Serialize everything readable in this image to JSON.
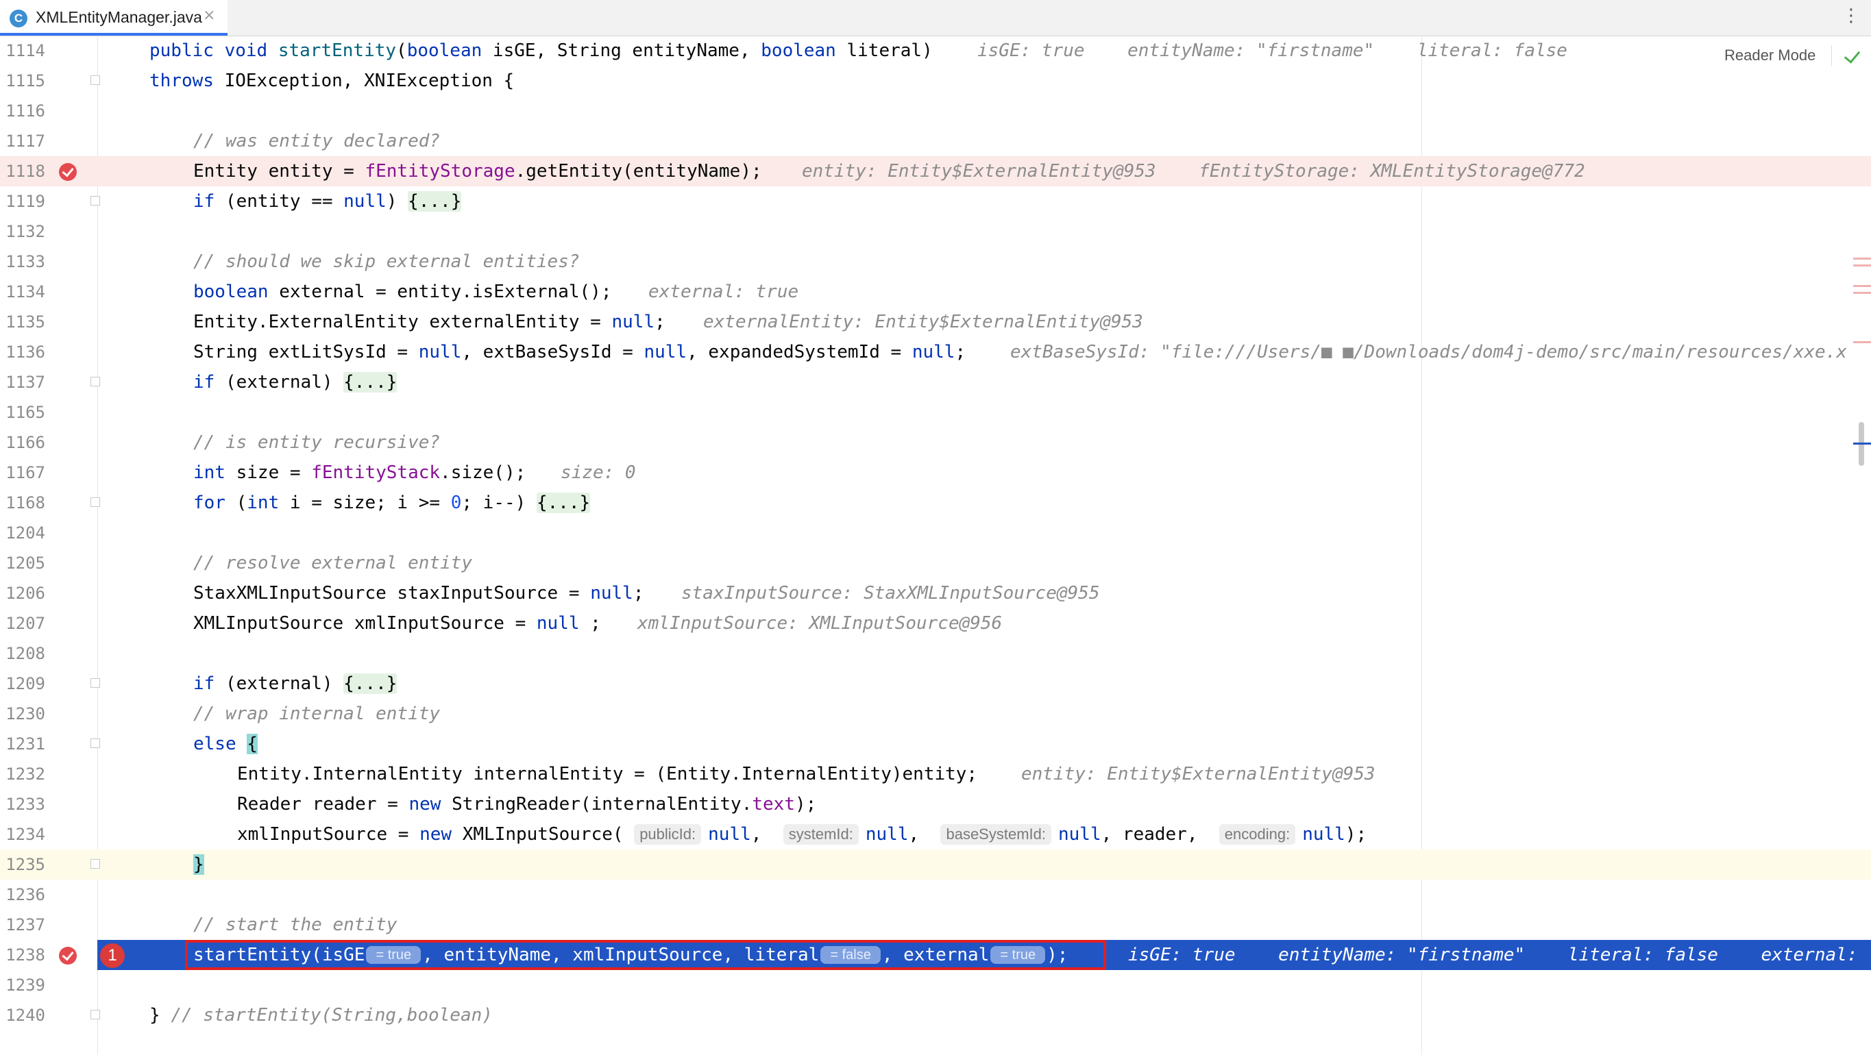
{
  "tab": {
    "icon_letter": "C",
    "file_name": "XMLEntityManager.java",
    "close_glyph": "×"
  },
  "editor": {
    "reader_mode_label": "Reader Mode",
    "lines": {
      "l1114": {
        "number": "1114",
        "hint": "isGE: true    entityName: \"firstname\"    literal: false"
      },
      "l1115": {
        "number": "1115"
      },
      "l1116": {
        "number": "1116"
      },
      "l1117": {
        "number": "1117",
        "comment": "// was entity declared?"
      },
      "l1118": {
        "number": "1118",
        "hint": "entity: Entity$ExternalEntity@953    fEntityStorage: XMLEntityStorage@772"
      },
      "l1119": {
        "number": "1119",
        "folded": "{...}"
      },
      "l1132": {
        "number": "1132"
      },
      "l1133": {
        "number": "1133",
        "comment": "// should we skip external entities?"
      },
      "l1134": {
        "number": "1134",
        "hint": "external: true"
      },
      "l1135": {
        "number": "1135",
        "hint": "externalEntity: Entity$ExternalEntity@953"
      },
      "l1136": {
        "number": "1136",
        "hint": "extBaseSysId: \"file:///Users/■ ■/Downloads/dom4j-demo/src/main/resources/xxe.x"
      },
      "l1137": {
        "number": "1137",
        "folded": "{...}"
      },
      "l1165": {
        "number": "1165"
      },
      "l1166": {
        "number": "1166",
        "comment": "// is entity recursive?"
      },
      "l1167": {
        "number": "1167",
        "hint": "size: 0"
      },
      "l1168": {
        "number": "1168",
        "folded": "{...}"
      },
      "l1204": {
        "number": "1204"
      },
      "l1205": {
        "number": "1205",
        "comment": "// resolve external entity"
      },
      "l1206": {
        "number": "1206",
        "hint": "staxInputSource: StaxXMLInputSource@955"
      },
      "l1207": {
        "number": "1207",
        "hint": "xmlInputSource: XMLInputSource@956"
      },
      "l1208": {
        "number": "1208"
      },
      "l1209": {
        "number": "1209",
        "folded": "{...}"
      },
      "l1230": {
        "number": "1230",
        "comment": "// wrap internal entity"
      },
      "l1231": {
        "number": "1231"
      },
      "l1232": {
        "number": "1232",
        "hint": "entity: Entity$ExternalEntity@953"
      },
      "l1233": {
        "number": "1233"
      },
      "l1234": {
        "number": "1234",
        "param_public": "publicId:",
        "param_system": "systemId:",
        "param_base": "baseSystemId:",
        "param_encoding": "encoding:"
      },
      "l1235": {
        "number": "1235"
      },
      "l1236": {
        "number": "1236"
      },
      "l1237": {
        "number": "1237",
        "comment": "// start the entity"
      },
      "l1238": {
        "number": "1238",
        "step_badge": "1",
        "chip_isGE": "= true",
        "chip_literal": "= false",
        "chip_external": "= true",
        "hint": "isGE: true    entityName: \"firstname\"    literal: false    external:"
      },
      "l1239": {
        "number": "1239"
      },
      "l1240": {
        "number": "1240",
        "comment": "// startEntity(String,boolean)"
      }
    }
  }
}
